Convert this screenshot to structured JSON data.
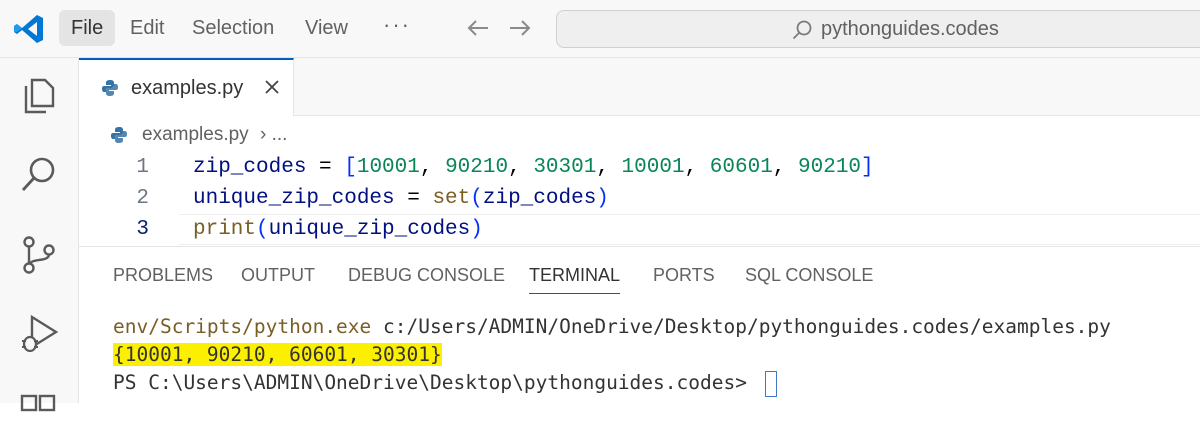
{
  "menu": {
    "file": "File",
    "edit": "Edit",
    "selection": "Selection",
    "view": "View",
    "more": "···"
  },
  "search": {
    "text": "pythonguides.codes"
  },
  "editor_tab": {
    "label": "examples.py",
    "close": "×"
  },
  "breadcrumb": {
    "file": "examples.py",
    "separator": "› ..."
  },
  "code": {
    "lines": [
      {
        "number": "1",
        "parts": [
          {
            "t": "zip_codes",
            "c": "var"
          },
          {
            "t": " = ",
            "c": "op"
          },
          {
            "t": "[",
            "c": "br"
          },
          {
            "t": "10001",
            "c": "num"
          },
          {
            "t": ", ",
            "c": "op"
          },
          {
            "t": "90210",
            "c": "num"
          },
          {
            "t": ", ",
            "c": "op"
          },
          {
            "t": "30301",
            "c": "num"
          },
          {
            "t": ", ",
            "c": "op"
          },
          {
            "t": "10001",
            "c": "num"
          },
          {
            "t": ", ",
            "c": "op"
          },
          {
            "t": "60601",
            "c": "num"
          },
          {
            "t": ", ",
            "c": "op"
          },
          {
            "t": "90210",
            "c": "num"
          },
          {
            "t": "]",
            "c": "br"
          }
        ]
      },
      {
        "number": "2",
        "parts": [
          {
            "t": "unique_zip_codes",
            "c": "var"
          },
          {
            "t": " = ",
            "c": "op"
          },
          {
            "t": "set",
            "c": "fn"
          },
          {
            "t": "(",
            "c": "br"
          },
          {
            "t": "zip_codes",
            "c": "var"
          },
          {
            "t": ")",
            "c": "br"
          }
        ]
      },
      {
        "number": "3",
        "parts": [
          {
            "t": "print",
            "c": "fn"
          },
          {
            "t": "(",
            "c": "br"
          },
          {
            "t": "unique_zip_codes",
            "c": "var"
          },
          {
            "t": ")",
            "c": "br"
          }
        ]
      }
    ]
  },
  "panel_tabs": [
    "PROBLEMS",
    "OUTPUT",
    "DEBUG CONSOLE",
    "TERMINAL",
    "PORTS",
    "SQL CONSOLE"
  ],
  "terminal": {
    "cmd": "env/Scripts/python.exe",
    "arg": " c:/Users/ADMIN/OneDrive/Desktop/pythonguides.codes/examples.py",
    "output": "{10001, 90210, 60601, 30301}",
    "prompt": "PS C:\\Users\\ADMIN\\OneDrive\\Desktop\\pythonguides.codes> "
  },
  "colors": {
    "accent": "#005fb8",
    "highlight": "#fcf000",
    "number": "#098658",
    "function": "#795e26",
    "variable": "#001080"
  },
  "icons": [
    "vscode-logo-icon",
    "arrow-left-icon",
    "arrow-right-icon",
    "search-icon",
    "explorer-icon",
    "search-sidebar-icon",
    "source-control-icon",
    "run-debug-icon",
    "extensions-icon",
    "python-file-icon",
    "close-icon"
  ]
}
